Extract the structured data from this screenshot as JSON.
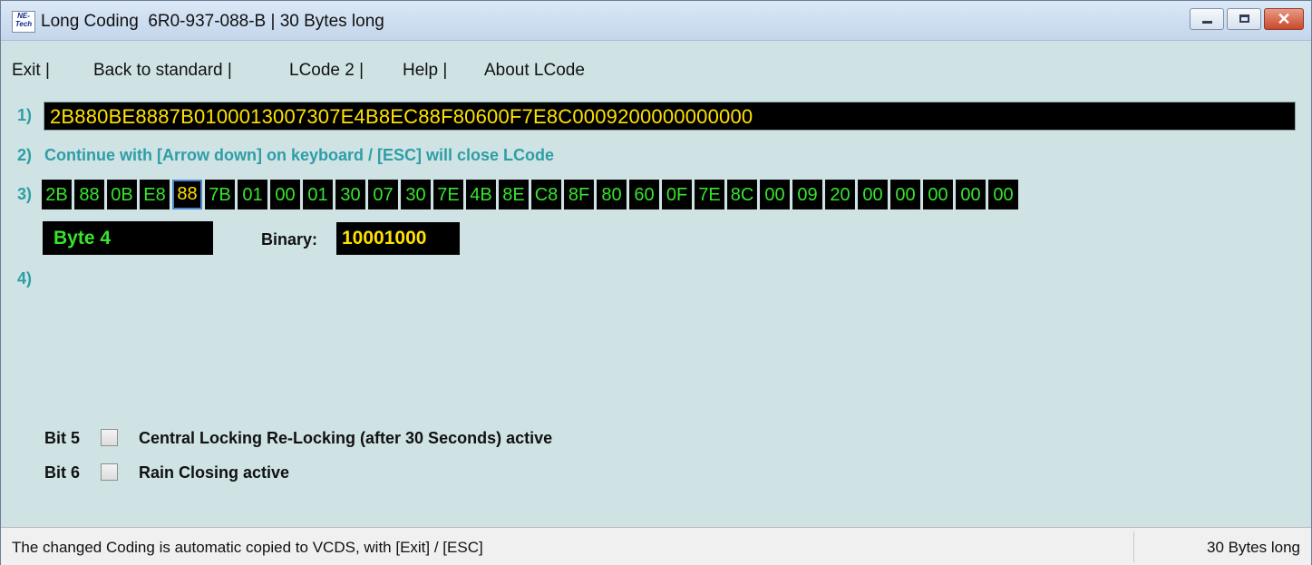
{
  "window": {
    "icon_text_top": "NE-",
    "icon_text_bottom": "Tech",
    "title": "Long Coding  6R0-937-088-B | 30 Bytes long",
    "close_glyph": "✕"
  },
  "menu": {
    "items": [
      {
        "label": "Exit |"
      },
      {
        "label": "Back to standard |"
      },
      {
        "label": "LCode 2 |"
      },
      {
        "label": "Help |"
      },
      {
        "label": "About LCode"
      }
    ]
  },
  "row1": {
    "label": "1)",
    "coding": "2B880BE8887B0100013007307E4B8EC88F80600F7E8C0009200000000000"
  },
  "row2": {
    "label": "2)",
    "instruction": "Continue with [Arrow down] on keyboard / [ESC] will close LCode"
  },
  "row3": {
    "label": "3)",
    "bytes": [
      "2B",
      "88",
      "0B",
      "E8",
      "88",
      "7B",
      "01",
      "00",
      "01",
      "30",
      "07",
      "30",
      "7E",
      "4B",
      "8E",
      "C8",
      "8F",
      "80",
      "60",
      "0F",
      "7E",
      "8C",
      "00",
      "09",
      "20",
      "00",
      "00",
      "00",
      "00",
      "00"
    ],
    "selected_index": 4,
    "byte_label": "Byte 4",
    "binary_label": "Binary:",
    "binary_value": "10001000"
  },
  "row4": {
    "label": "4)"
  },
  "bits": [
    {
      "name": "Bit 5",
      "description": "Central Locking Re-Locking (after 30 Seconds) active",
      "checked": false
    },
    {
      "name": "Bit 6",
      "description": "Rain Closing active",
      "checked": false
    }
  ],
  "status": {
    "message": "The changed Coding is automatic copied to VCDS, with [Exit] / [ESC]",
    "length": "30 Bytes long"
  },
  "colors": {
    "background": "#cfe3e5",
    "label_teal": "#2e9ea6",
    "byte_green": "#36e62b",
    "value_yellow": "#ffe100",
    "field_black": "#000000"
  }
}
